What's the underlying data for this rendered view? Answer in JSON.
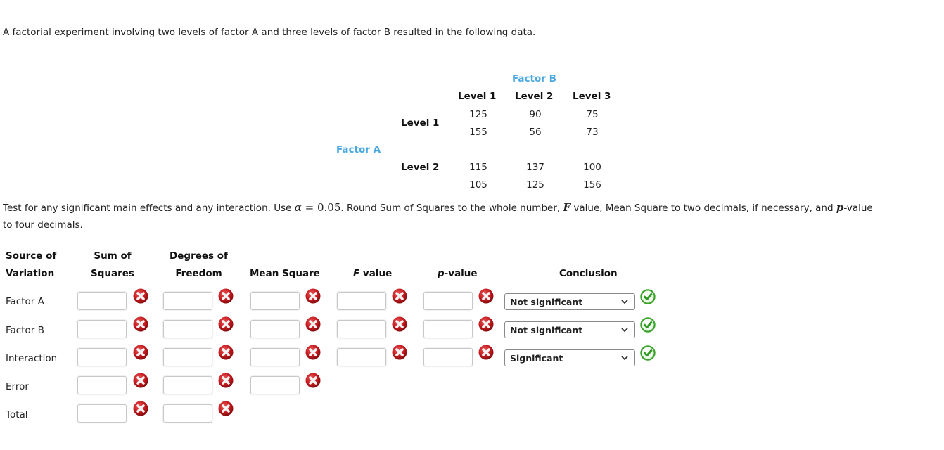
{
  "question": {
    "intro": "A factorial experiment involving two levels of factor A and three levels of factor B resulted in the following data.",
    "instructions": {
      "part1": "Test for any significant main effects and any interaction. Use ",
      "alpha_symbol": "α",
      "alpha_eq": " = 0.05",
      "part2": ". Round Sum of Squares to the whole number, ",
      "F_symbol": "F",
      "part3": " value, Mean Square to two decimals, if necessary, and ",
      "p_symbol": "p",
      "part4": "-value",
      "line2": "to four decimals."
    }
  },
  "data_table": {
    "factor_b_label": "Factor B",
    "factor_a_label": "Factor A",
    "column_levels": [
      "Level 1",
      "Level 2",
      "Level 3"
    ],
    "rows": [
      {
        "level": "Level 1",
        "values": [
          [
            "125",
            "155"
          ],
          [
            "90",
            "56"
          ],
          [
            "75",
            "73"
          ]
        ]
      },
      {
        "level": "Level 2",
        "values": [
          [
            "115",
            "105"
          ],
          [
            "137",
            "125"
          ],
          [
            "100",
            "156"
          ]
        ]
      }
    ]
  },
  "anova": {
    "headers": {
      "source_line1": "Source of",
      "source_line2": "Variation",
      "ss_line1": "Sum of",
      "ss_line2": "Squares",
      "df_line1": "Degrees of",
      "df_line2": "Freedom",
      "ms": "Mean Square",
      "f_italic": "F",
      "f_rest": " value",
      "p_italic": "p",
      "p_rest": "-value",
      "conclusion": "Conclusion"
    },
    "rows": [
      {
        "source": "Factor A",
        "ss": "",
        "df": "",
        "ms": "",
        "f": "",
        "p": "",
        "conclusion": "Not significant",
        "ss_status": "incorrect",
        "df_status": "incorrect",
        "ms_status": "incorrect",
        "f_status": "incorrect",
        "p_status": "incorrect",
        "conclusion_status": "correct"
      },
      {
        "source": "Factor B",
        "ss": "",
        "df": "",
        "ms": "",
        "f": "",
        "p": "",
        "conclusion": "Not significant",
        "ss_status": "incorrect",
        "df_status": "incorrect",
        "ms_status": "incorrect",
        "f_status": "incorrect",
        "p_status": "incorrect",
        "conclusion_status": "correct"
      },
      {
        "source": "Interaction",
        "ss": "",
        "df": "",
        "ms": "",
        "f": "",
        "p": "",
        "conclusion": "Significant",
        "ss_status": "incorrect",
        "df_status": "incorrect",
        "ms_status": "incorrect",
        "f_status": "incorrect",
        "p_status": "incorrect",
        "conclusion_status": "correct"
      },
      {
        "source": "Error",
        "ss": "",
        "df": "",
        "ms": "",
        "ss_status": "incorrect",
        "df_status": "incorrect",
        "ms_status": "incorrect"
      },
      {
        "source": "Total",
        "ss": "",
        "df": "",
        "ss_status": "incorrect",
        "df_status": "incorrect"
      }
    ]
  },
  "icons": {
    "incorrect": "red-x-icon",
    "correct": "green-check-icon"
  },
  "colors": {
    "factor_label": "#4aa8e0",
    "incorrect": "#c0181c",
    "correct": "#3aa52a"
  }
}
